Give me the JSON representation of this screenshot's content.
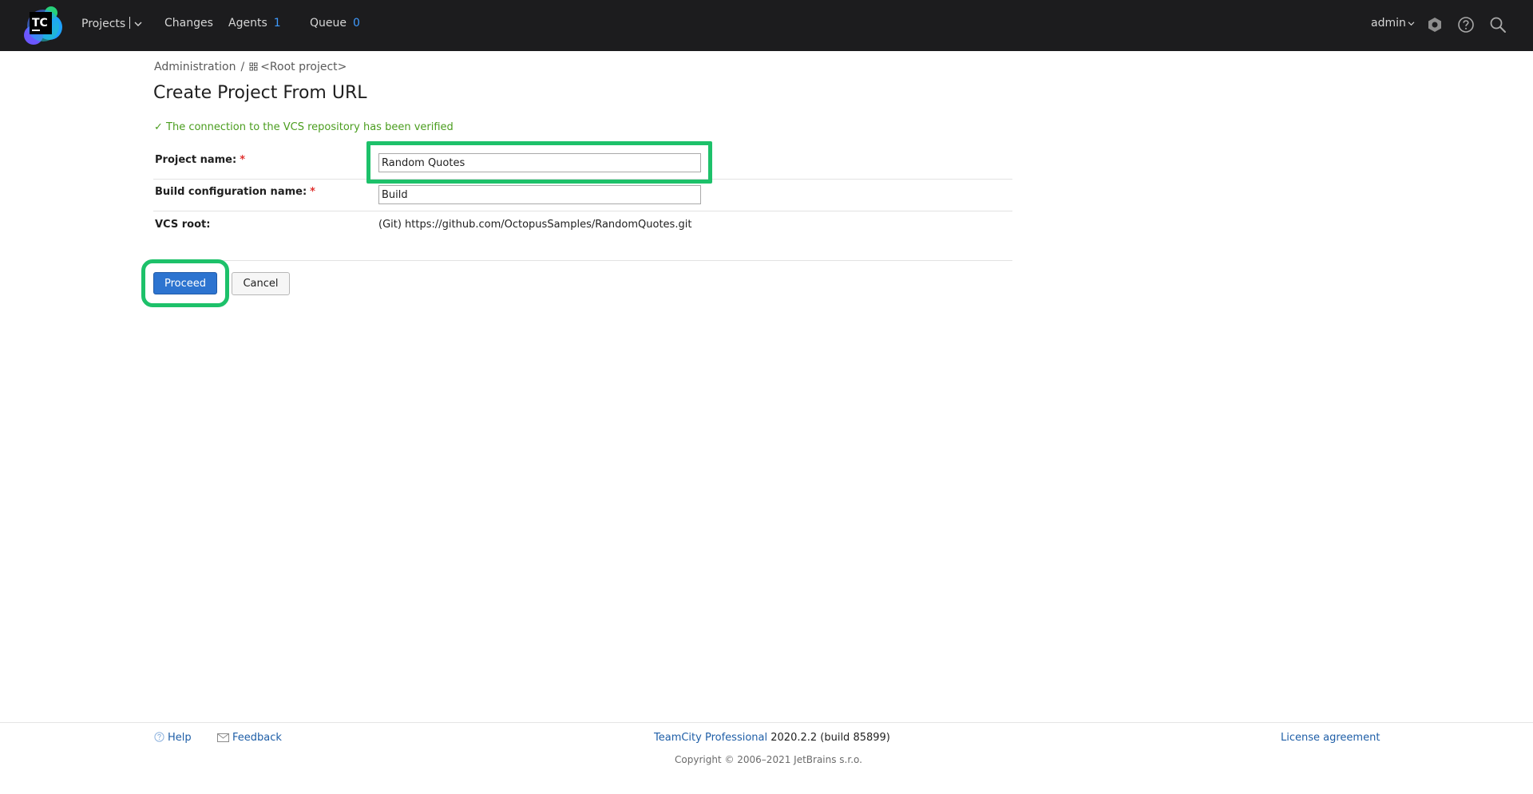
{
  "header": {
    "logo_text": "TC",
    "nav": {
      "projects": "Projects",
      "changes": "Changes",
      "agents": "Agents",
      "agents_count": "1",
      "queue": "Queue",
      "queue_count": "0"
    },
    "user": "admin",
    "icons": [
      "settings-hexagon-icon",
      "help-icon",
      "search-icon"
    ]
  },
  "breadcrumb": {
    "admin": "Administration",
    "separator": "/",
    "root": "<Root project>"
  },
  "page": {
    "title": "Create Project From URL",
    "verified_message": "✓ The connection to the VCS repository has been verified"
  },
  "form": {
    "project_name_label": "Project name:",
    "project_name_value": "Random Quotes",
    "build_config_label": "Build configuration name:",
    "build_config_value": "Build",
    "vcs_root_label": "VCS root:",
    "vcs_root_value": "(Git) https://github.com/OctopusSamples/RandomQuotes.git",
    "required_mark": "*"
  },
  "buttons": {
    "proceed": "Proceed",
    "cancel": "Cancel"
  },
  "footer": {
    "help": "Help",
    "feedback": "Feedback",
    "product_name": "TeamCity Professional",
    "version": "2020.2.2 (build 85899)",
    "license": "License agreement",
    "copyright": "Copyright © 2006–2021 JetBrains s.r.o."
  },
  "colors": {
    "topbar": "#1c1c1e",
    "accent_blue": "#2d74d0",
    "link_blue": "#1e5ea7",
    "success_green": "#4a9d1e",
    "highlight_green": "#1dc16a",
    "required_red": "#e0312f"
  }
}
